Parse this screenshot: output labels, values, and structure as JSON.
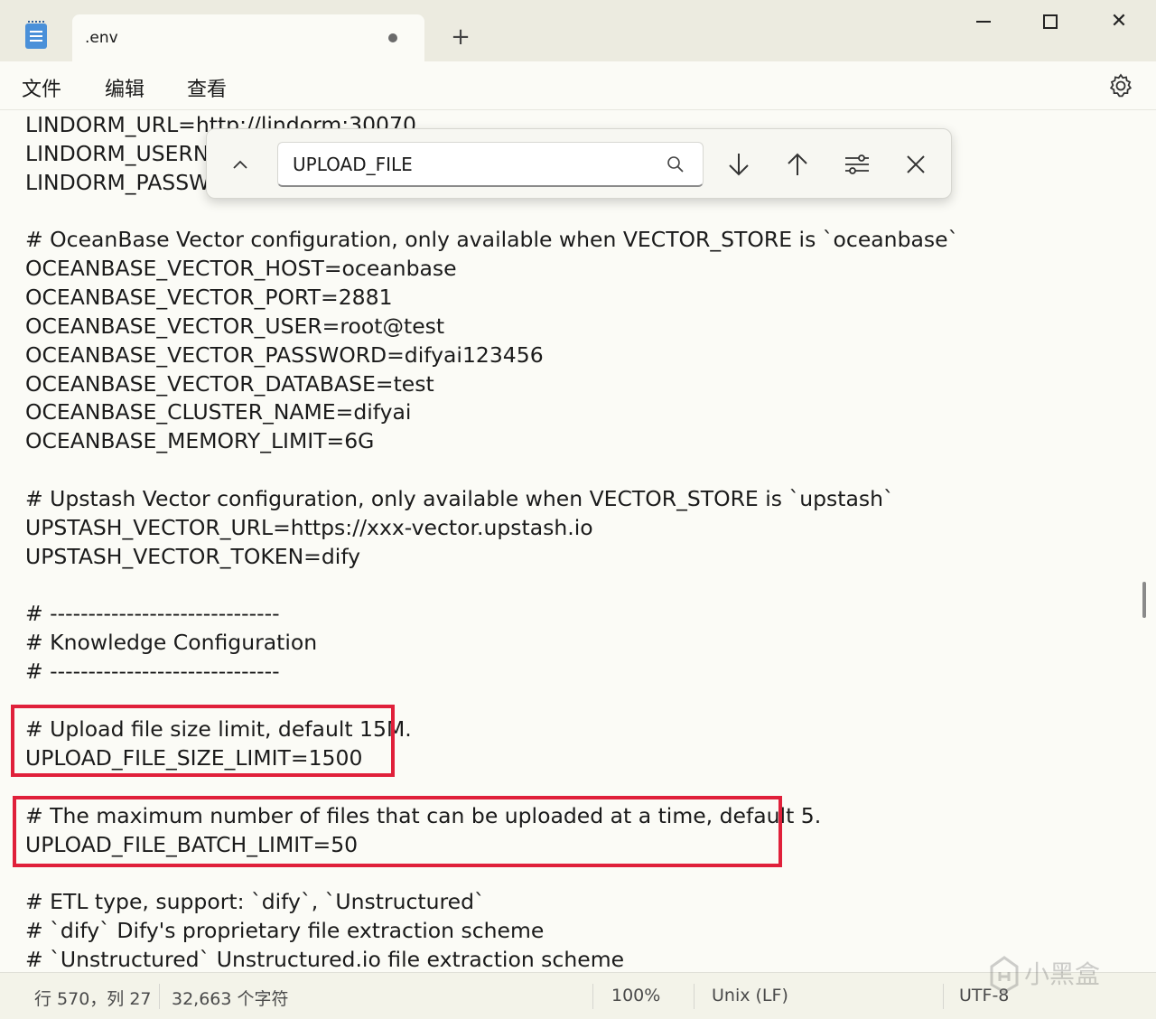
{
  "window": {
    "tab_title": ".env",
    "new_tab": "+",
    "close_glyph": "✕"
  },
  "menu": {
    "file": "文件",
    "edit": "编辑",
    "view": "查看"
  },
  "find": {
    "query": "UPLOAD_FILE"
  },
  "editor": {
    "lines": [
      "LINDORM_URL=http://lindorm:30070",
      "LINDORM_USERN",
      "LINDORM_PASSW",
      "",
      "# OceanBase Vector configuration, only available when VECTOR_STORE is `oceanbase`",
      "OCEANBASE_VECTOR_HOST=oceanbase",
      "OCEANBASE_VECTOR_PORT=2881",
      "OCEANBASE_VECTOR_USER=root@test",
      "OCEANBASE_VECTOR_PASSWORD=difyai123456",
      "OCEANBASE_VECTOR_DATABASE=test",
      "OCEANBASE_CLUSTER_NAME=difyai",
      "OCEANBASE_MEMORY_LIMIT=6G",
      "",
      "# Upstash Vector configuration, only available when VECTOR_STORE is `upstash`",
      "UPSTASH_VECTOR_URL=https://xxx-vector.upstash.io",
      "UPSTASH_VECTOR_TOKEN=dify",
      "",
      "# ------------------------------",
      "# Knowledge Configuration",
      "# ------------------------------",
      "",
      "# Upload file size limit, default 15M.",
      "UPLOAD_FILE_SIZE_LIMIT=1500",
      "",
      "# The maximum number of files that can be uploaded at a time, default 5.",
      "UPLOAD_FILE_BATCH_LIMIT=50",
      "",
      "# ETL type, support: `dify`, `Unstructured`",
      "# `dify` Dify's proprietary file extraction scheme",
      "# `Unstructured` Unstructured.io file extraction scheme"
    ]
  },
  "status": {
    "position": "行 570，列 27",
    "chars": "32,663 个字符",
    "zoom": "100%",
    "line_ending": "Unix (LF)",
    "encoding": "UTF-8"
  },
  "watermark": {
    "text": "小黑盒"
  },
  "colors": {
    "highlight": "#e0203a",
    "accent": "#4a90d9"
  }
}
